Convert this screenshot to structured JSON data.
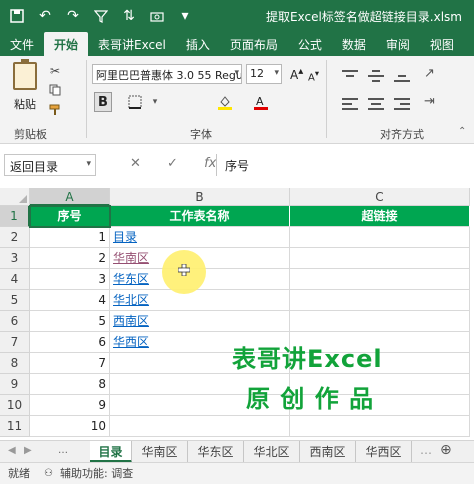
{
  "window": {
    "title": "提取Excel标签名做超链接目录.xlsm",
    "toolbar_icons": [
      "save-icon",
      "undo-icon",
      "redo-icon",
      "filter-icon",
      "sort-icon",
      "camera-icon",
      "dropdown-icon"
    ]
  },
  "ribbon": {
    "tabs": [
      "文件",
      "开始",
      "表哥讲Excel",
      "插入",
      "页面布局",
      "公式",
      "数据",
      "审阅",
      "视图"
    ],
    "active_tab": "开始",
    "paste_label": "粘贴",
    "clipboard_label": "剪贴板",
    "font_group_label": "字体",
    "alignment_group_label": "对齐方式",
    "font_name": "阿里巴巴普惠体 3.0 55 Regu",
    "font_size": "12",
    "grow_label": "A",
    "shrink_label": "A",
    "bold_label": "B"
  },
  "formula_bar": {
    "name_box": "返回目录",
    "cancel_symbol": "✕",
    "enter_symbol": "✓",
    "fx_symbol": "fx",
    "content": "序号"
  },
  "columns": [
    "A",
    "B",
    "C"
  ],
  "rows": [
    "1",
    "2",
    "3",
    "4",
    "5",
    "6",
    "7",
    "8",
    "9",
    "10",
    "11"
  ],
  "header_row": [
    "序号",
    "工作表名称",
    "超链接"
  ],
  "data_rows": [
    {
      "num": "1",
      "name": "目录"
    },
    {
      "num": "2",
      "name": "华南区"
    },
    {
      "num": "3",
      "name": "华东区"
    },
    {
      "num": "4",
      "name": "华北区"
    },
    {
      "num": "5",
      "name": "西南区"
    },
    {
      "num": "6",
      "name": "华西区"
    },
    {
      "num": "7",
      "name": ""
    },
    {
      "num": "8",
      "name": ""
    },
    {
      "num": "9",
      "name": ""
    },
    {
      "num": "10",
      "name": ""
    }
  ],
  "watermark": [
    "表哥讲Excel",
    "原 创 作 品"
  ],
  "sheet_tabs": [
    "目录",
    "华南区",
    "华东区",
    "华北区",
    "西南区",
    "华西区"
  ],
  "active_sheet": "目录",
  "status": {
    "ready": "就绪",
    "accessibility": "辅助功能: 调查"
  },
  "colors": {
    "excel_green": "#217346",
    "header_fill": "#00a651",
    "link_blue": "#0563c1",
    "watermark_green": "#12a33a",
    "highlight_yellow": "#fff06e"
  }
}
